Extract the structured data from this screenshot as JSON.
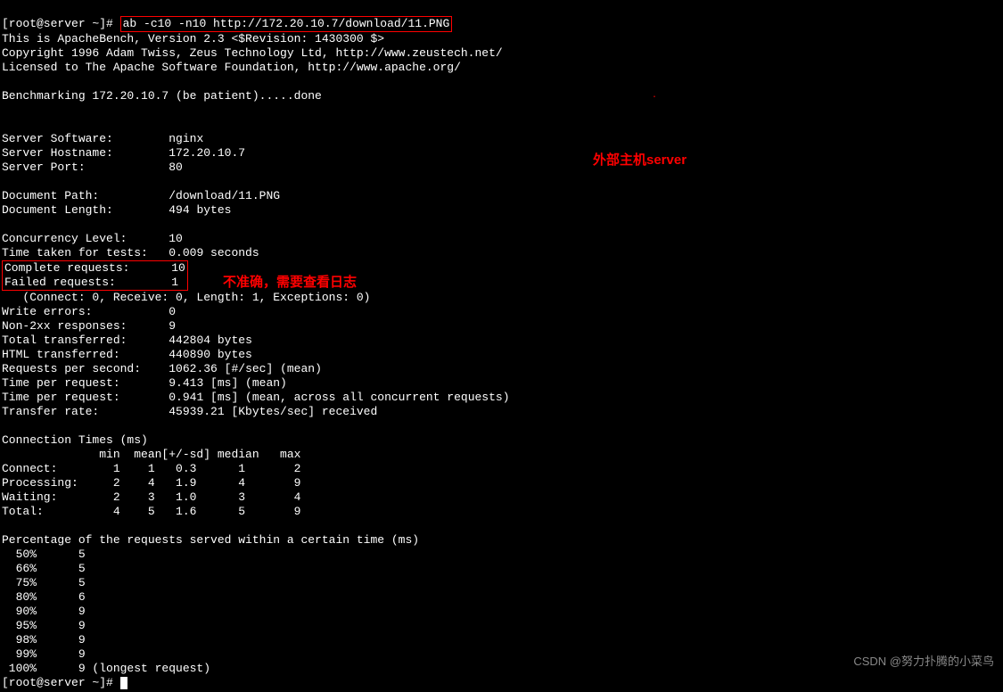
{
  "prompt1": "[root@server ~]# ",
  "command": "ab -c10 -n10 http://172.20.10.7/download/11.PNG",
  "header": {
    "line1": "This is ApacheBench, Version 2.3 <$Revision: 1430300 $>",
    "line2": "Copyright 1996 Adam Twiss, Zeus Technology Ltd, http://www.zeustech.net/",
    "line3": "Licensed to The Apache Software Foundation, http://www.apache.org/"
  },
  "benchmarking": "Benchmarking 172.20.10.7 (be patient).....done",
  "server": {
    "software_label": "Server Software:",
    "software": "nginx",
    "hostname_label": "Server Hostname:",
    "hostname": "172.20.10.7",
    "port_label": "Server Port:",
    "port": "80"
  },
  "document": {
    "path_label": "Document Path:",
    "path": "/download/11.PNG",
    "length_label": "Document Length:",
    "length": "494 bytes"
  },
  "results": {
    "concurrency_label": "Concurrency Level:",
    "concurrency": "10",
    "time_label": "Time taken for tests:",
    "time": "0.009 seconds",
    "complete_label": "Complete requests:",
    "complete": "10",
    "failed_label": "Failed requests:",
    "failed": "1",
    "failed_detail": "   (Connect: 0, Receive: 0, Length: 1, Exceptions: 0)",
    "write_errors_label": "Write errors:",
    "write_errors": "0",
    "non2xx_label": "Non-2xx responses:",
    "non2xx": "9",
    "total_transferred_label": "Total transferred:",
    "total_transferred": "442804 bytes",
    "html_transferred_label": "HTML transferred:",
    "html_transferred": "440890 bytes",
    "rps_label": "Requests per second:",
    "rps": "1062.36 [#/sec] (mean)",
    "tpr1_label": "Time per request:",
    "tpr1": "9.413 [ms] (mean)",
    "tpr2_label": "Time per request:",
    "tpr2": "0.941 [ms] (mean, across all concurrent requests)",
    "transfer_label": "Transfer rate:",
    "transfer": "45939.21 [Kbytes/sec] received"
  },
  "conn_times": {
    "title": "Connection Times (ms)",
    "header": "              min  mean[+/-sd] median   max",
    "connect": "Connect:        1    1   0.3      1       2",
    "processing": "Processing:     2    4   1.9      4       9",
    "waiting": "Waiting:        2    3   1.0      3       4",
    "total": "Total:          4    5   1.6      5       9"
  },
  "percentiles": {
    "title": "Percentage of the requests served within a certain time (ms)",
    "p50": "  50%      5",
    "p66": "  66%      5",
    "p75": "  75%      5",
    "p80": "  80%      6",
    "p90": "  90%      9",
    "p95": "  95%      9",
    "p98": "  98%      9",
    "p99": "  99%      9",
    "p100": " 100%      9 (longest request)"
  },
  "prompt2": "[root@server ~]# ",
  "annotations": {
    "external_host": "外部主机server",
    "inaccurate": "不准确，需要查看日志"
  },
  "watermark": "CSDN @努力扑腾的小菜鸟"
}
